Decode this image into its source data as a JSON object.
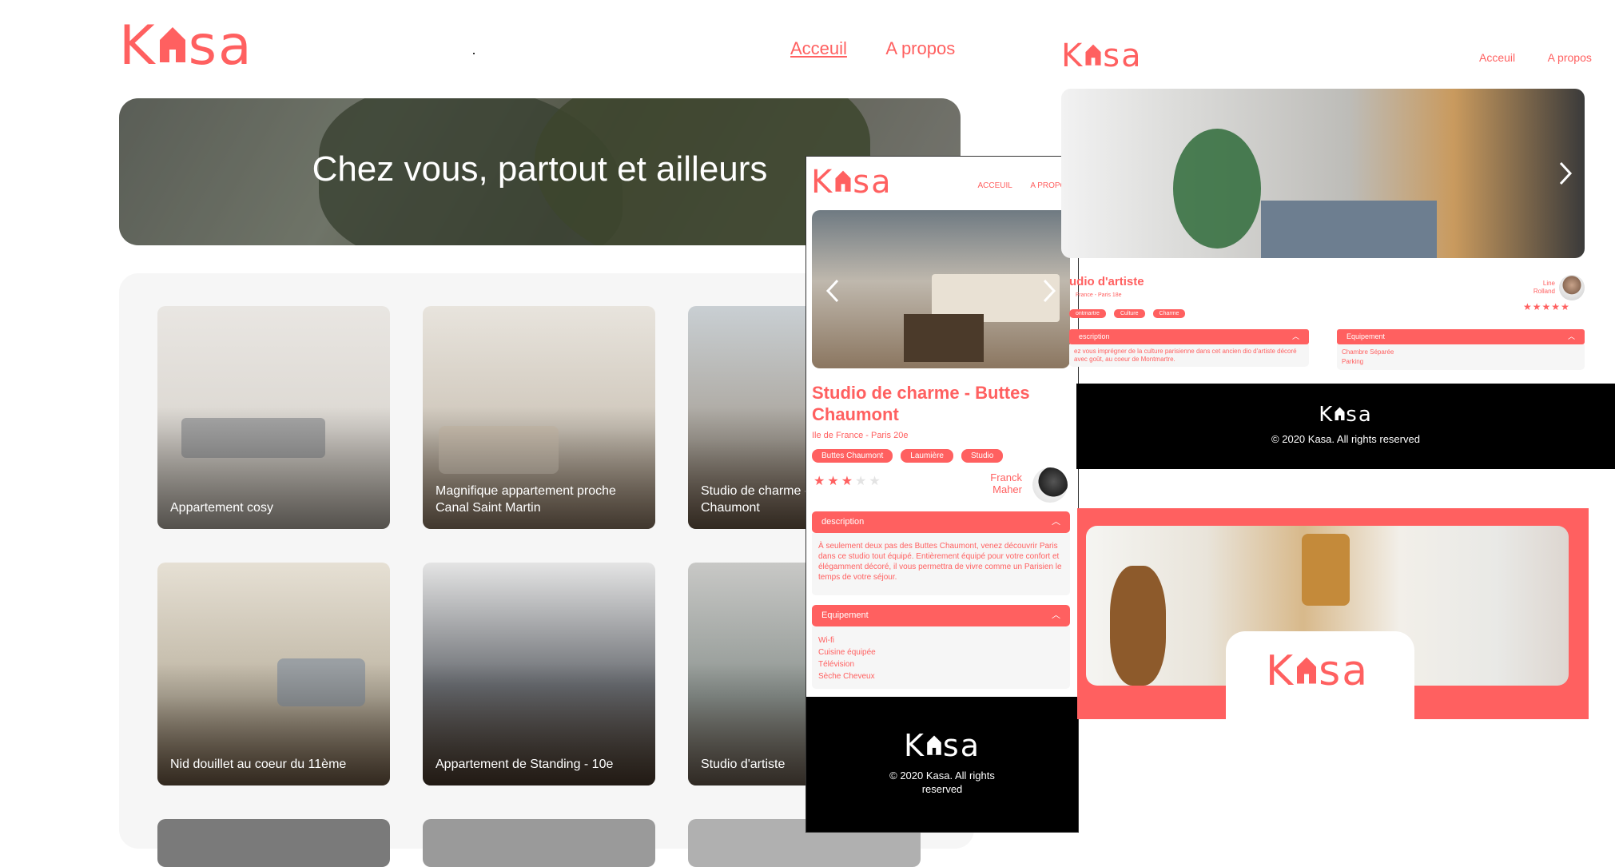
{
  "brand": {
    "name": "Kasa",
    "accent": "#FF6060",
    "gray": "#F6F6F6"
  },
  "home": {
    "nav": {
      "home": "Acceuil",
      "about": "A propos"
    },
    "banner_title": "Chez vous, partout et ailleurs",
    "cards": [
      {
        "title": "Appartement cosy"
      },
      {
        "title": "Magnifique appartement proche Canal Saint Martin"
      },
      {
        "title": "Studio de charme - Buttes Chaumont"
      },
      {
        "title": "Nid douillet au coeur du 11ème"
      },
      {
        "title": "Appartement de Standing - 10e"
      },
      {
        "title": "Studio d'artiste"
      }
    ]
  },
  "mobile": {
    "nav": {
      "home": "ACCEUIL",
      "about": "A PROPOS"
    },
    "title": "Studio de charme - Buttes Chaumont",
    "location": "Ile de France - Paris 20e",
    "tags": [
      "Buttes Chaumont",
      "Laumière",
      "Studio"
    ],
    "rating": 3,
    "host": "Franck Maher",
    "description_label": "description",
    "description_text": "À seulement deux pas des Buttes Chaumont, venez découvrir Paris dans ce studio tout équipé. Entièrement équipé pour votre confort et élégamment décoré, il vous permettra de vivre comme un Parisien le temps de votre séjour.",
    "equipment_label": "Equipement",
    "equipments": [
      "Wi-fi",
      "Cuisine équipée",
      "Télévision",
      "Sèche Cheveux"
    ],
    "footer": "© 2020 Kasa. All rights reserved"
  },
  "detail": {
    "nav": {
      "home": "Acceuil",
      "about": "A propos"
    },
    "title": "udio d'artiste",
    "location": "France - Paris 18e",
    "tags": [
      "ontmartre",
      "Culture",
      "Charme"
    ],
    "host": "Line Rolland",
    "rating": 5,
    "description_label": "escription",
    "description_text": "ez vous imprégner de la culture parisienne dans cet ancien dio d'artiste décoré avec goût, au coeur de Montmartre.",
    "equipment_label": "Equipement",
    "equipments": [
      "Chambre Séparée",
      "Parking"
    ],
    "footer": "© 2020 Kasa. All rights reserved"
  },
  "icons": [
    "kasa-house-icon",
    "chevron-left-icon",
    "chevron-right-icon",
    "chevron-up-icon",
    "star-icon",
    "host-avatar"
  ]
}
